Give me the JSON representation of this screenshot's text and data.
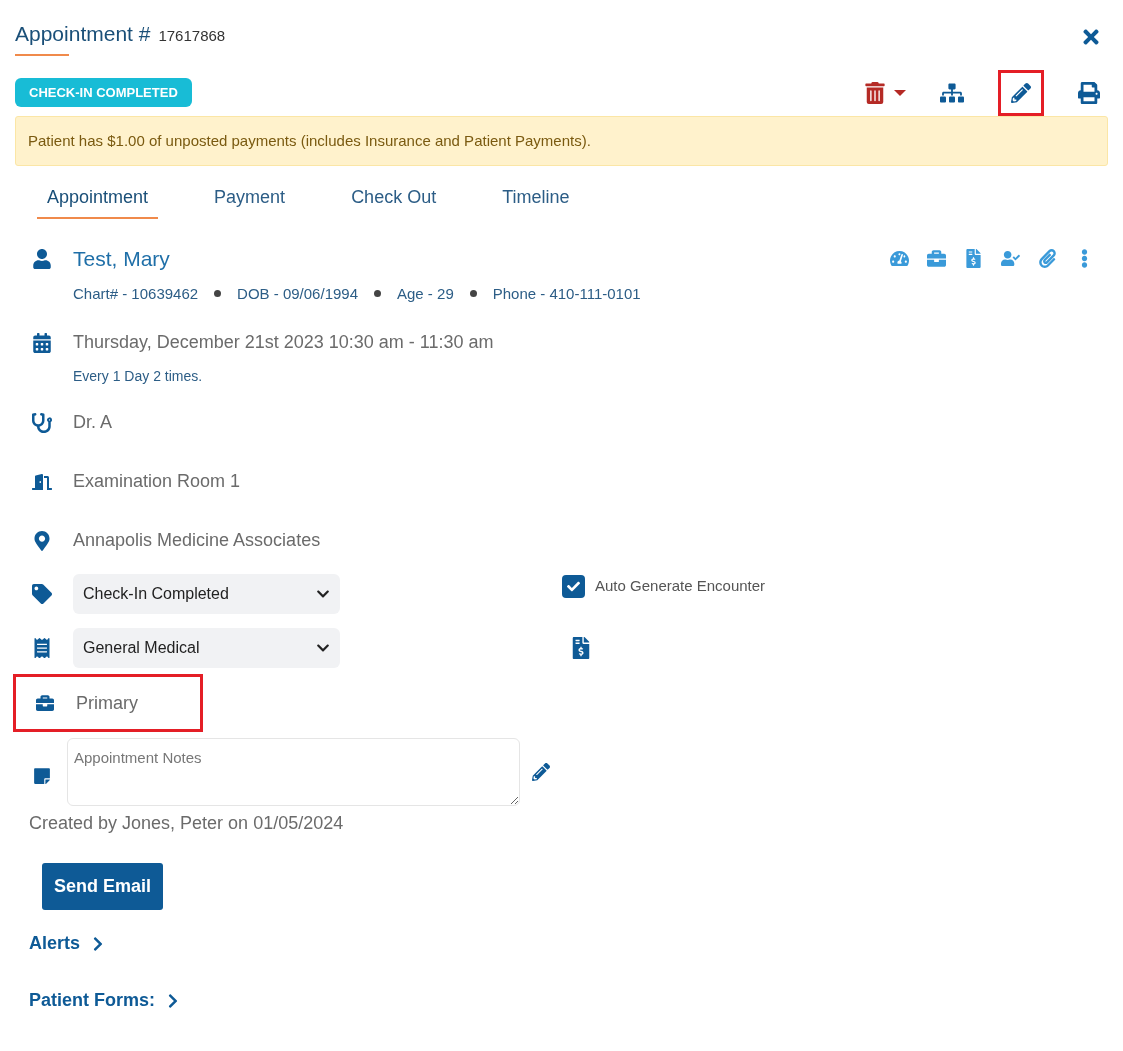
{
  "header": {
    "title": "Appointment #",
    "number": "17617868"
  },
  "status_badge": "CHECK-IN COMPLETED",
  "toolbar": {
    "edit_highlighted": true
  },
  "alert": "Patient has $1.00 of unposted payments (includes Insurance and Patient Payments).",
  "tabs": [
    {
      "label": "Appointment",
      "selected": true
    },
    {
      "label": "Payment",
      "selected": false
    },
    {
      "label": "Check Out",
      "selected": false
    },
    {
      "label": "Timeline",
      "selected": false
    }
  ],
  "patient": {
    "name": "Test, Mary",
    "details": [
      "Chart# - 10639462",
      "DOB - 09/06/1994",
      "Age - 29",
      "Phone - 410-111-0101"
    ]
  },
  "schedule": {
    "when": "Thursday, December 21st 2023 10:30 am - 11:30 am",
    "recurrence": "Every 1 Day 2 times."
  },
  "provider": "Dr. A",
  "room": "Examination Room 1",
  "location": "Annapolis Medicine Associates",
  "status_select": {
    "value": "Check-In Completed"
  },
  "auto_generate": {
    "label": "Auto Generate Encounter",
    "checked": true
  },
  "type_select": {
    "value": "General Medical"
  },
  "insurance": {
    "label": "Primary",
    "highlighted": true
  },
  "notes": {
    "placeholder": "Appointment Notes"
  },
  "created": "Created by Jones, Peter on 01/05/2024",
  "send_email": "Send Email",
  "links": [
    "Alerts",
    "Patient Forms:"
  ]
}
